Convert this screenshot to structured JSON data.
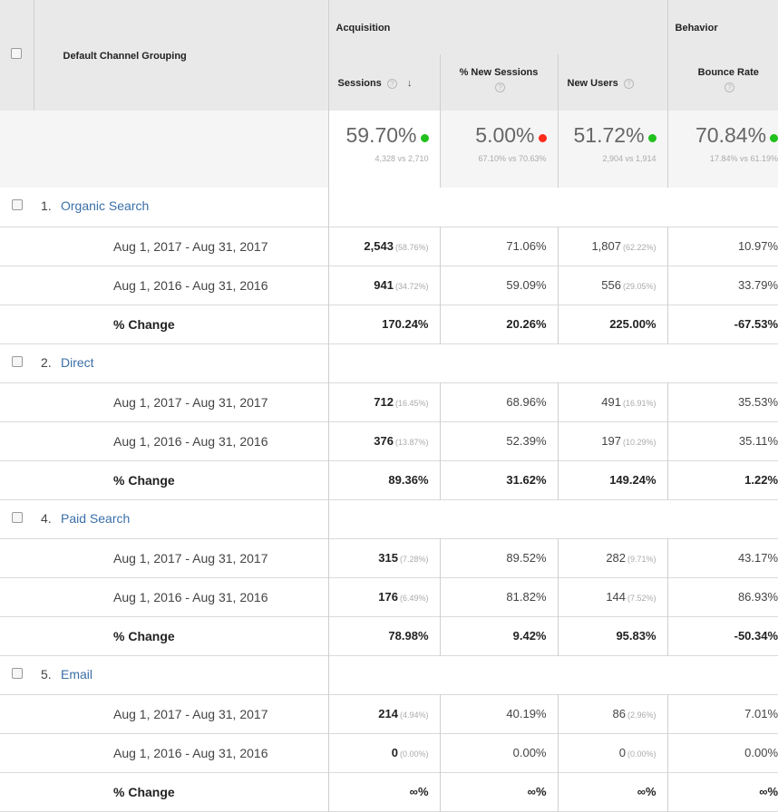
{
  "header": {
    "dimension_title": "Default Channel Grouping",
    "acquisition_title": "Acquisition",
    "behavior_title": "Behavior",
    "columns": [
      {
        "label": "Sessions",
        "sortable": true
      },
      {
        "label": "% New Sessions"
      },
      {
        "label": "New Users"
      },
      {
        "label": "Bounce Rate"
      }
    ],
    "help_glyph": "?",
    "sort_glyph": "↓"
  },
  "summary": [
    {
      "pct": "59.70%",
      "indicator": "green",
      "sub": "4,328 vs 2,710"
    },
    {
      "pct": "5.00%",
      "indicator": "red",
      "sub": "67.10% vs 70.63%"
    },
    {
      "pct": "51.72%",
      "indicator": "green",
      "sub": "2,904 vs 1,914"
    },
    {
      "pct": "70.84%",
      "indicator": "green",
      "sub": "17.84% vs 61.19%"
    }
  ],
  "colors": {
    "positive": "#21c01d",
    "negative": "#ff2a1a",
    "link": "#3a6fa8",
    "header_bg": "#e9e9e9"
  },
  "groups": [
    {
      "index": "1.",
      "channel": "Organic Search",
      "rows": [
        {
          "label": "Aug 1, 2017 - Aug 31, 2017",
          "sessions": "2,543",
          "sessions_pct": "(58.76%)",
          "new_sessions": "71.06%",
          "new_users": "1,807",
          "new_users_pct": "(62.22%)",
          "bounce_rate": "10.97%"
        },
        {
          "label": "Aug 1, 2016 - Aug 31, 2016",
          "sessions": "941",
          "sessions_pct": "(34.72%)",
          "new_sessions": "59.09%",
          "new_users": "556",
          "new_users_pct": "(29.05%)",
          "bounce_rate": "33.79%"
        }
      ],
      "change": {
        "label": "% Change",
        "sessions": "170.24%",
        "new_sessions": "20.26%",
        "new_users": "225.00%",
        "bounce_rate": "-67.53%"
      }
    },
    {
      "index": "2.",
      "channel": "Direct",
      "rows": [
        {
          "label": "Aug 1, 2017 - Aug 31, 2017",
          "sessions": "712",
          "sessions_pct": "(16.45%)",
          "new_sessions": "68.96%",
          "new_users": "491",
          "new_users_pct": "(16.91%)",
          "bounce_rate": "35.53%"
        },
        {
          "label": "Aug 1, 2016 - Aug 31, 2016",
          "sessions": "376",
          "sessions_pct": "(13.87%)",
          "new_sessions": "52.39%",
          "new_users": "197",
          "new_users_pct": "(10.29%)",
          "bounce_rate": "35.11%"
        }
      ],
      "change": {
        "label": "% Change",
        "sessions": "89.36%",
        "new_sessions": "31.62%",
        "new_users": "149.24%",
        "bounce_rate": "1.22%"
      }
    },
    {
      "index": "4.",
      "channel": "Paid Search",
      "rows": [
        {
          "label": "Aug 1, 2017 - Aug 31, 2017",
          "sessions": "315",
          "sessions_pct": "(7.28%)",
          "new_sessions": "89.52%",
          "new_users": "282",
          "new_users_pct": "(9.71%)",
          "bounce_rate": "43.17%"
        },
        {
          "label": "Aug 1, 2016 - Aug 31, 2016",
          "sessions": "176",
          "sessions_pct": "(6.49%)",
          "new_sessions": "81.82%",
          "new_users": "144",
          "new_users_pct": "(7.52%)",
          "bounce_rate": "86.93%"
        }
      ],
      "change": {
        "label": "% Change",
        "sessions": "78.98%",
        "new_sessions": "9.42%",
        "new_users": "95.83%",
        "bounce_rate": "-50.34%"
      }
    },
    {
      "index": "5.",
      "channel": "Email",
      "rows": [
        {
          "label": "Aug 1, 2017 - Aug 31, 2017",
          "sessions": "214",
          "sessions_pct": "(4.94%)",
          "new_sessions": "40.19%",
          "new_users": "86",
          "new_users_pct": "(2.96%)",
          "bounce_rate": "7.01%"
        },
        {
          "label": "Aug 1, 2016 - Aug 31, 2016",
          "sessions": "0",
          "sessions_pct": "(0.00%)",
          "new_sessions": "0.00%",
          "new_users": "0",
          "new_users_pct": "(0.00%)",
          "bounce_rate": "0.00%"
        }
      ],
      "change": {
        "label": "% Change",
        "sessions": "∞%",
        "new_sessions": "∞%",
        "new_users": "∞%",
        "bounce_rate": "∞%"
      }
    }
  ]
}
